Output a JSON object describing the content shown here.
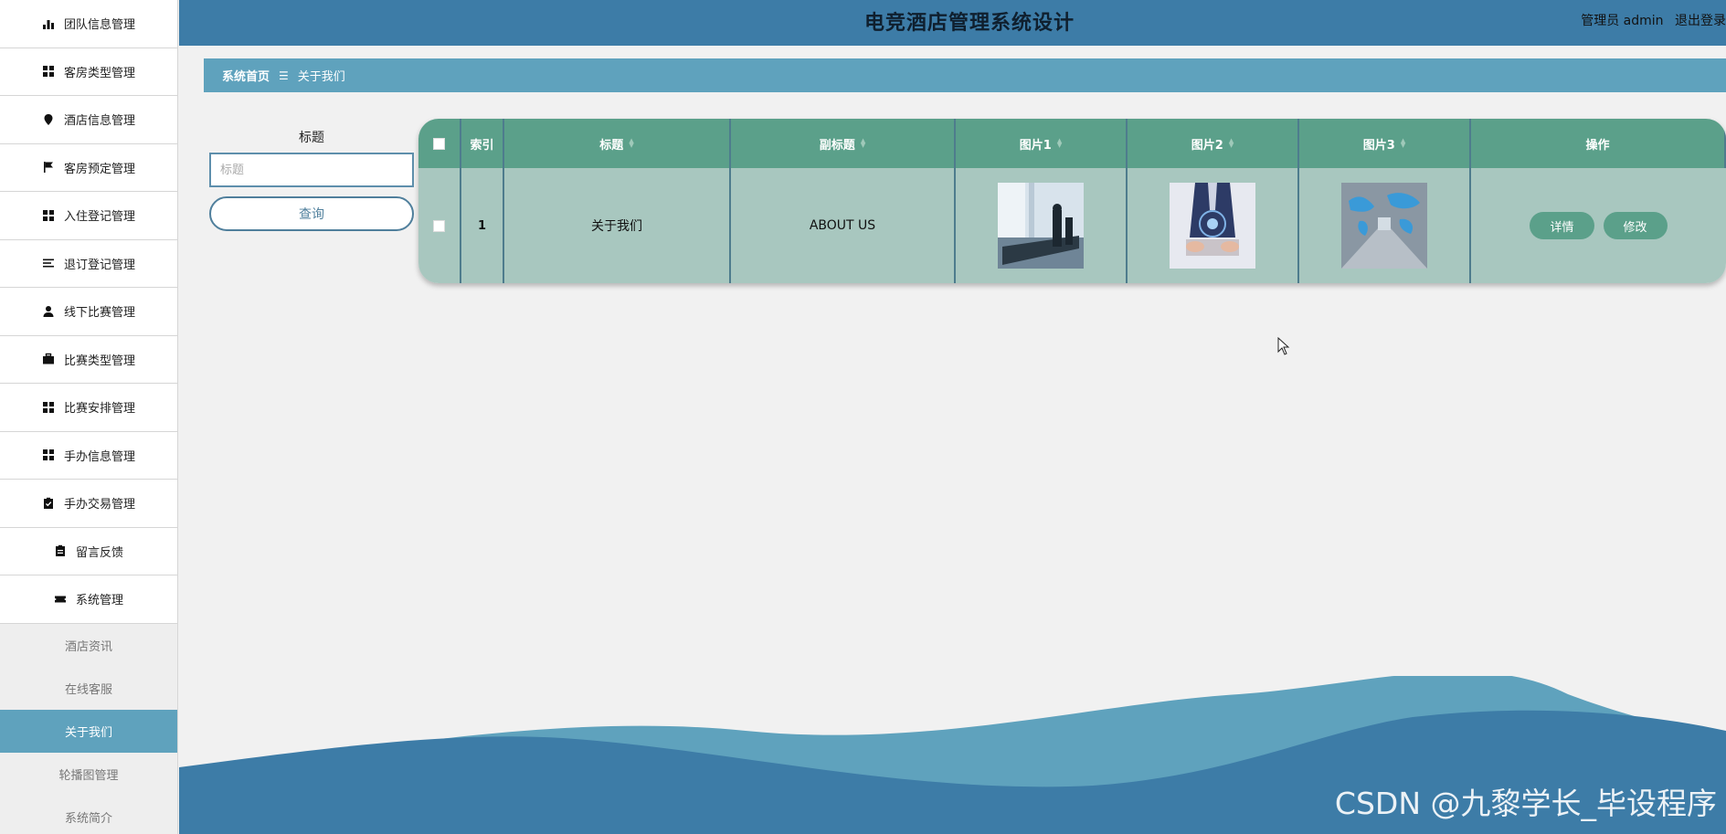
{
  "app": {
    "title": "电竞酒店管理系统设计",
    "user_label": "管理员 admin",
    "logout_label": "退出登录"
  },
  "sidebar": {
    "items": [
      {
        "label": "团队信息管理",
        "icon": "bar-chart-icon"
      },
      {
        "label": "客房类型管理",
        "icon": "grid-icon"
      },
      {
        "label": "酒店信息管理",
        "icon": "map-pin-icon"
      },
      {
        "label": "客房预定管理",
        "icon": "flag-icon"
      },
      {
        "label": "入住登记管理",
        "icon": "grid-icon"
      },
      {
        "label": "退订登记管理",
        "icon": "list-icon"
      },
      {
        "label": "线下比赛管理",
        "icon": "user-icon"
      },
      {
        "label": "比赛类型管理",
        "icon": "briefcase-icon"
      },
      {
        "label": "比赛安排管理",
        "icon": "grid-icon"
      },
      {
        "label": "手办信息管理",
        "icon": "grid-icon"
      },
      {
        "label": "手办交易管理",
        "icon": "clipboard-check-icon"
      },
      {
        "label": "留言反馈",
        "icon": "clipboard-icon"
      },
      {
        "label": "系统管理",
        "icon": "ticket-icon"
      }
    ],
    "sub_items": [
      {
        "label": "酒店资讯",
        "active": false
      },
      {
        "label": "在线客服",
        "active": false
      },
      {
        "label": "关于我们",
        "active": true
      },
      {
        "label": "轮播图管理",
        "active": false
      },
      {
        "label": "系统简介",
        "active": false
      }
    ]
  },
  "breadcrumb": {
    "home": "系统首页",
    "separator": "☰",
    "current": "关于我们"
  },
  "search": {
    "label": "标题",
    "placeholder": "标题",
    "button": "查询"
  },
  "table": {
    "headers": {
      "index": "索引",
      "title": "标题",
      "subtitle": "副标题",
      "image1": "图片1",
      "image2": "图片2",
      "image3": "图片3",
      "actions": "操作"
    },
    "rows": [
      {
        "index": "1",
        "title": "关于我们",
        "subtitle": "ABOUT US",
        "detail_button": "详情",
        "edit_button": "修改"
      }
    ]
  },
  "watermark": "CSDN @九黎学长_毕设程序",
  "colors": {
    "header": "#3d7ca7",
    "breadcrumb": "#5fa2bd",
    "table_header": "#5ba08a",
    "table_row": "#a8c7bf",
    "active_sub_item": "#5fa2bd"
  }
}
